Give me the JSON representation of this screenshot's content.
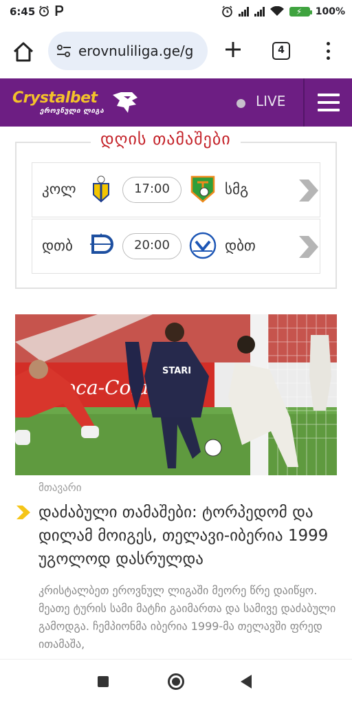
{
  "status_bar": {
    "time": "6:45",
    "battery": "100%",
    "left_icons": [
      "alarm-icon",
      "p-icon"
    ],
    "right_icons": [
      "alarm-icon",
      "signal-icon",
      "signal-icon",
      "wifi-icon",
      "battery-icon"
    ]
  },
  "browser": {
    "url": "erovnuliliga.ge/g",
    "tab_count": "4"
  },
  "site_header": {
    "brand": "Crystalbet",
    "brand_sub": "ეროვნული ლიგა",
    "live_label": "LIVE",
    "colors": {
      "header_bg": "#6d1e83",
      "brand_yellow": "#f4c22a"
    }
  },
  "matches": {
    "title": "დღის თამაშები",
    "items": [
      {
        "home": "კოლ",
        "time": "17:00",
        "away": "სმგ"
      },
      {
        "home": "დთბ",
        "time": "20:00",
        "away": "დბთ"
      }
    ]
  },
  "news": {
    "category": "მთავარი",
    "title": "დაძაბული თამაშები: ტორპედომ და დილამ მოიგეს, თელავი-იბერია 1999 უგოლოდ დასრულდა",
    "excerpt": "კრისტალბეთ ეროვნულ ლიგაში მეორე წრე დაიწყო. მეათე ტურის სამი მატჩი გაიმართა და სამივე დაძაბული გამოდგა. ჩემპიონმა იბერია 1999-მა თელავში ფრედ ითამაშა,"
  },
  "image": {
    "sponsor_text": "Coca-Cola",
    "shirt_text": "STARI"
  }
}
